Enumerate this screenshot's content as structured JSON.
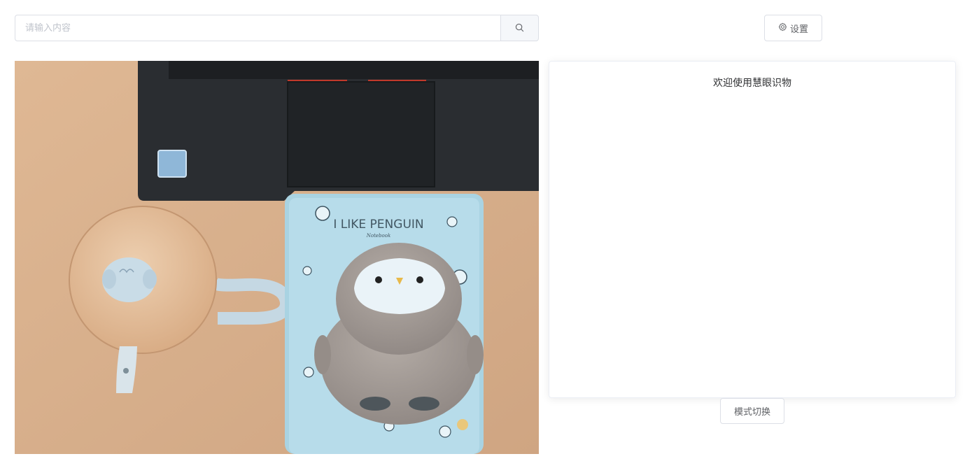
{
  "search": {
    "placeholder": "请输入内容",
    "value": "",
    "icon": "search-icon"
  },
  "toolbar": {
    "settings_label": "设置",
    "settings_icon": "gear-icon"
  },
  "camera": {
    "notebook_title": "I LIKE PENGUIN",
    "notebook_subtitle": "Notebook"
  },
  "result": {
    "title": "欢迎使用慧眼识物"
  },
  "mode": {
    "switch_label": "模式切换"
  },
  "colors": {
    "border": "#dcdfe6",
    "placeholder": "#c0c4cc",
    "text": "#606266"
  }
}
